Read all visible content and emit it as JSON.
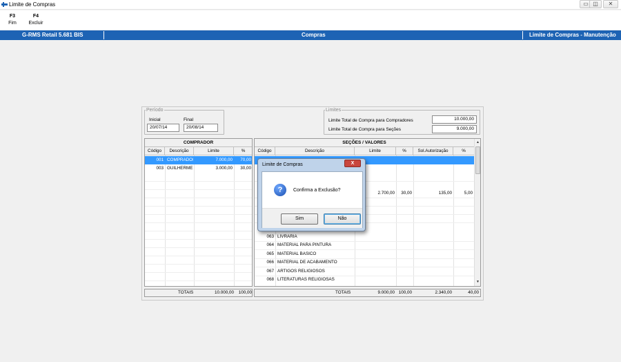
{
  "window": {
    "title": "Limite de Compras"
  },
  "fkeys": [
    {
      "key": "F3",
      "label": "Fim"
    },
    {
      "key": "F4",
      "label": "Excluir"
    }
  ],
  "banner": {
    "left": "G-RMS Retail 5.681 BIS",
    "center": "Compras",
    "right": "Limite de Compras - Manutenção"
  },
  "periodo": {
    "legend": "Período",
    "inicial_label": "Inicial",
    "final_label": "Final",
    "inicial_value": "20/07/14",
    "final_value": "20/08/14"
  },
  "limites": {
    "legend": "Limites",
    "compradores_label": "Limite Total de Compra para Compradores",
    "compradores_value": "10.000,00",
    "secoes_label": "Limite Total de Compra para Seções",
    "secoes_value": "9.000,00"
  },
  "comprador": {
    "title": "COMPRADOR",
    "columns": [
      "Código",
      "Descrição",
      "Limite",
      "%"
    ],
    "rows": [
      {
        "codigo": "001",
        "descricao": "COMPRADOR",
        "limite": "7.000,00",
        "pct": "70,00"
      },
      {
        "codigo": "003",
        "descricao": "GUILHERME",
        "limite": "3.000,00",
        "pct": "30,00"
      }
    ],
    "totals": {
      "label": "TOTAIS",
      "limite": "10.000,00",
      "pct": "100,00"
    }
  },
  "secoes": {
    "title": "SEÇÕES / VALORES",
    "columns": [
      "Código",
      "Descrição",
      "Limite",
      "%",
      "Sol.Autorização",
      "%"
    ],
    "value_row": {
      "limite": "2.700,00",
      "pct": "30,00",
      "sol": "135,00",
      "pct2": "5,00"
    },
    "items": [
      {
        "codigo": "063",
        "descricao": "LIVRARIA"
      },
      {
        "codigo": "064",
        "descricao": "MATERIAL PARA PINTURA"
      },
      {
        "codigo": "065",
        "descricao": "MATERIAL BASICO"
      },
      {
        "codigo": "066",
        "descricao": "MATERIAL DE ACABAMENTO"
      },
      {
        "codigo": "067",
        "descricao": "ARTIGOS RELIGIOSOS"
      },
      {
        "codigo": "068",
        "descricao": "LITERATURAS RELIGIOSAS"
      }
    ],
    "totals": {
      "label": "TOTAIS",
      "limite": "9.000,00",
      "pct": "100,00",
      "sol": "2.340,00",
      "pct2": "40,00"
    }
  },
  "dialog": {
    "title": "Limite de Compras",
    "close": "X",
    "icon": "question-icon",
    "message": "Confirma a Exclusão?",
    "yes": "Sim",
    "no": "Não"
  }
}
